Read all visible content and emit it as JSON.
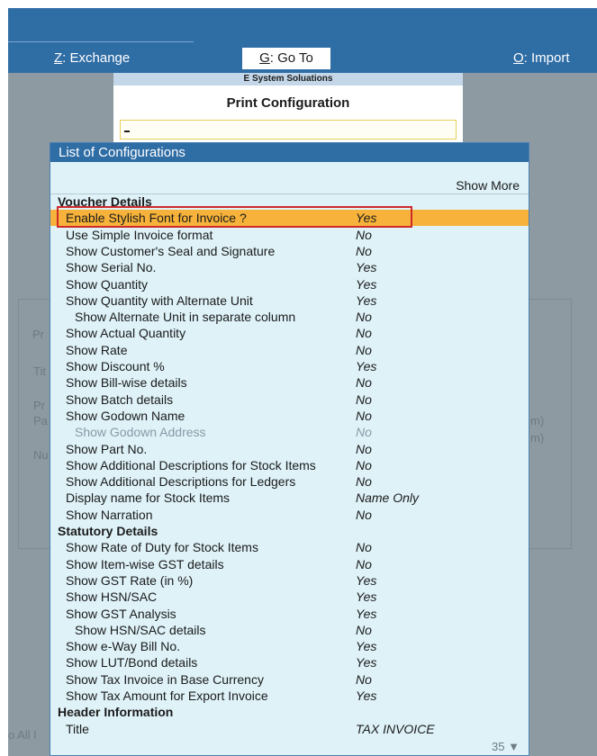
{
  "topnav": {
    "exchange": {
      "key": "Z",
      "label": ": Exchange"
    },
    "goto": {
      "key": "G",
      "label": ": Go To"
    },
    "import": {
      "key": "O",
      "label": ": Import"
    }
  },
  "company_name": "E System Soluations",
  "print_config": {
    "title": "Print Configuration",
    "input_value": ""
  },
  "background_fragments": [
    "Pr",
    "Tit",
    "Pr",
    "Pa",
    "Nu",
    "m)",
    "m)",
    "o All I"
  ],
  "list": {
    "title": "List of Configurations",
    "show_more": "Show More",
    "scroll_count": "35 ▼",
    "rows": [
      {
        "label": "Voucher Details",
        "value": "",
        "kind": "section"
      },
      {
        "label": "Enable Stylish Font for Invoice ?",
        "value": "Yes",
        "kind": "selected"
      },
      {
        "label": "Use Simple Invoice format",
        "value": "No",
        "kind": "item"
      },
      {
        "label": "Show Customer's Seal and Signature",
        "value": "No",
        "kind": "item"
      },
      {
        "label": "Show Serial No.",
        "value": "Yes",
        "kind": "item"
      },
      {
        "label": "Show Quantity",
        "value": "Yes",
        "kind": "item"
      },
      {
        "label": "Show Quantity with Alternate Unit",
        "value": "Yes",
        "kind": "item"
      },
      {
        "label": "Show Alternate Unit in separate column",
        "value": "No",
        "kind": "indent"
      },
      {
        "label": "Show Actual Quantity",
        "value": "No",
        "kind": "item"
      },
      {
        "label": "Show Rate",
        "value": "No",
        "kind": "item"
      },
      {
        "label": "Show Discount %",
        "value": "Yes",
        "kind": "item"
      },
      {
        "label": "Show Bill-wise details",
        "value": "No",
        "kind": "item"
      },
      {
        "label": "Show Batch details",
        "value": "No",
        "kind": "item"
      },
      {
        "label": "Show Godown Name",
        "value": "No",
        "kind": "item"
      },
      {
        "label": "Show Godown Address",
        "value": "No",
        "kind": "muted"
      },
      {
        "label": "Show Part No.",
        "value": "No",
        "kind": "item"
      },
      {
        "label": "Show Additional Descriptions for Stock Items",
        "value": "No",
        "kind": "item"
      },
      {
        "label": "Show Additional Descriptions for Ledgers",
        "value": "No",
        "kind": "item"
      },
      {
        "label": "Display name for Stock Items",
        "value": "Name Only",
        "kind": "item"
      },
      {
        "label": "Show Narration",
        "value": "No",
        "kind": "item"
      },
      {
        "label": "Statutory Details",
        "value": "",
        "kind": "section"
      },
      {
        "label": "Show Rate of Duty for Stock Items",
        "value": "No",
        "kind": "item"
      },
      {
        "label": "Show Item-wise GST details",
        "value": "No",
        "kind": "item"
      },
      {
        "label": "Show GST Rate (in %)",
        "value": "Yes",
        "kind": "item"
      },
      {
        "label": "Show HSN/SAC",
        "value": "Yes",
        "kind": "item"
      },
      {
        "label": "Show GST Analysis",
        "value": "Yes",
        "kind": "item"
      },
      {
        "label": "Show HSN/SAC details",
        "value": "No",
        "kind": "indent"
      },
      {
        "label": "Show e-Way Bill No.",
        "value": "Yes",
        "kind": "item"
      },
      {
        "label": "Show LUT/Bond details",
        "value": "Yes",
        "kind": "item"
      },
      {
        "label": "Show Tax Invoice in Base Currency",
        "value": "No",
        "kind": "item"
      },
      {
        "label": "Show Tax Amount for Export Invoice",
        "value": "Yes",
        "kind": "item"
      },
      {
        "label": "Header Information",
        "value": "",
        "kind": "section"
      },
      {
        "label": "Title",
        "value": "TAX INVOICE",
        "kind": "item"
      }
    ]
  }
}
